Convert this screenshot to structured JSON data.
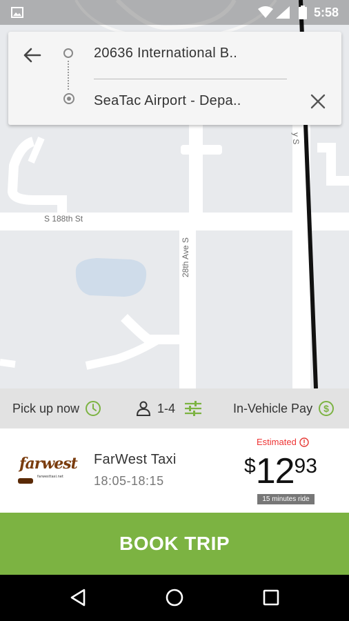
{
  "status_bar": {
    "time": "5:58",
    "icons": [
      "image-icon",
      "wifi-icon",
      "signal-icon",
      "battery-icon"
    ]
  },
  "map": {
    "road_labels": {
      "street_188th": "S 188th St",
      "avenue_28th": "28th Ave S",
      "way_s": "y S"
    }
  },
  "route": {
    "origin": "20636 International B..",
    "destination": "SeaTac Airport - Depa..",
    "back_icon": "arrow-left-icon",
    "clear_icon": "close-icon"
  },
  "options": {
    "pickup_label": "Pick up now",
    "seats_label": "1-4",
    "payment_label": "In-Vehicle Pay",
    "accent_color": "#7cb342"
  },
  "taxi": {
    "logo_text": "farwest",
    "logo_subtext": "farwesttaxi.net",
    "company_name": "FarWest Taxi",
    "time_range": "18:05-18:15",
    "estimated_label": "Estimated",
    "price_currency": "$",
    "price_dollars": "12",
    "price_cents": "93",
    "ride_duration": "15 minutes ride",
    "estimated_color": "#e53935"
  },
  "book_button": {
    "label": "BOOK TRIP",
    "color": "#7cb342"
  },
  "nav_bar": {
    "icons": [
      "nav-back-icon",
      "nav-home-icon",
      "nav-recent-icon"
    ]
  }
}
